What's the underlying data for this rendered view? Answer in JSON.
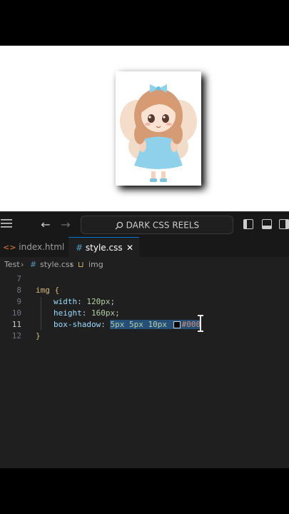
{
  "titlebar": {
    "search_label": "DARK CSS REELS"
  },
  "tabs": [
    {
      "label": "index.html",
      "icon": "html-icon"
    },
    {
      "label": "style.css",
      "icon": "hash-icon",
      "close": "✕"
    }
  ],
  "breadcrumb": {
    "folder": "Test",
    "file": "style.css",
    "symbol": "img"
  },
  "editor": {
    "line_numbers": [
      "7",
      "8",
      "9",
      "10",
      "11",
      "12"
    ],
    "lines": {
      "l8": "img {",
      "l9_prop": "width",
      "l9_val": "120px",
      "l10_prop": "height",
      "l10_val": "160px",
      "l11_prop": "box-shadow",
      "l11_val": "5px 5px 10px",
      "l11_color": "#000",
      "l12": "}"
    }
  },
  "colors": {
    "accent": "#0078d4",
    "selector": "#d7ba7d",
    "property": "#9cdcfe",
    "value": "#b5cea8"
  }
}
